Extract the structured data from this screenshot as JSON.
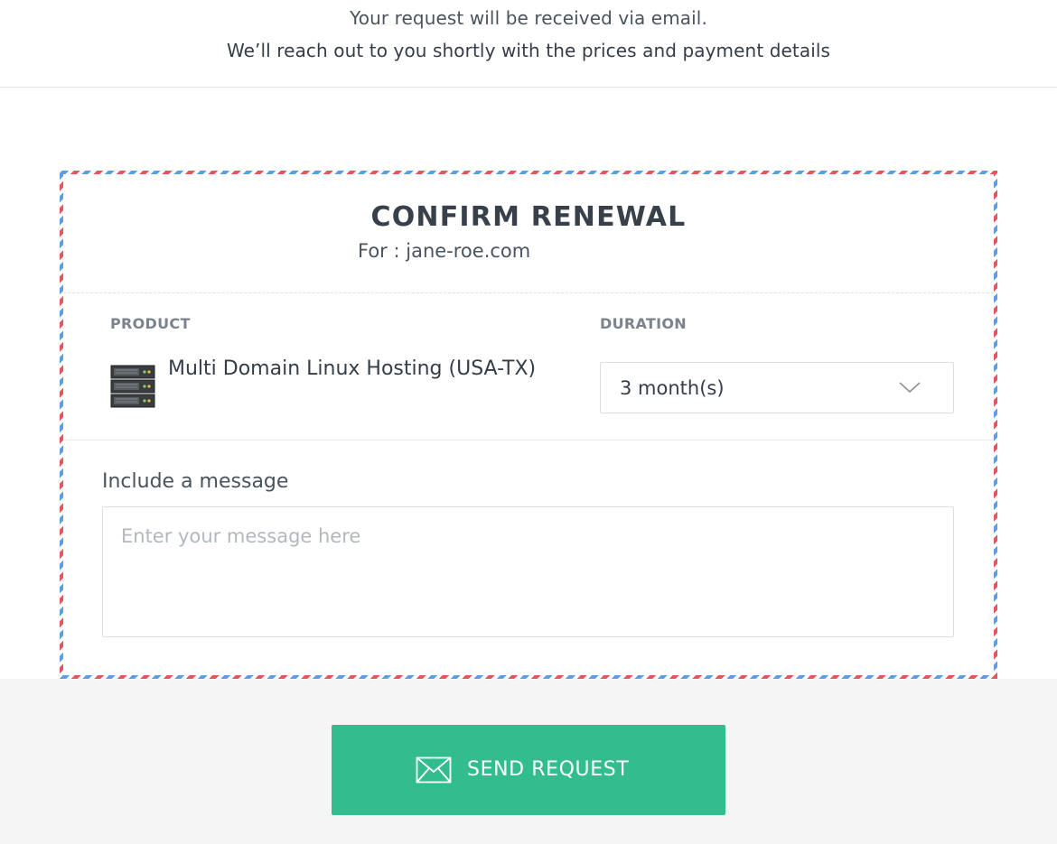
{
  "notice": {
    "line1": "Your request will be received via email.",
    "line2": "We’ll reach out to you shortly with the prices and payment details"
  },
  "form": {
    "title": "CONFIRM RENEWAL",
    "for_text": "For : jane-roe.com",
    "columns": {
      "product_label": "PRODUCT",
      "duration_label": "DURATION"
    },
    "product": {
      "icon": "server-icon",
      "name": "Multi Domain Linux Hosting (USA-TX)"
    },
    "duration": {
      "selected": "3 month(s)",
      "icon": "chevron-down-icon"
    },
    "message": {
      "label": "Include a message",
      "value": "",
      "placeholder": "Enter your message here"
    }
  },
  "actions": {
    "send_label": "SEND REQUEST",
    "send_icon": "mail-icon"
  },
  "colors": {
    "accent": "#33bd8e",
    "airmail_red": "#e8545d",
    "airmail_blue": "#5b9ee6",
    "text_dark": "#353e48",
    "label_gray": "#7b838c",
    "band_gray": "#f5f5f5"
  }
}
